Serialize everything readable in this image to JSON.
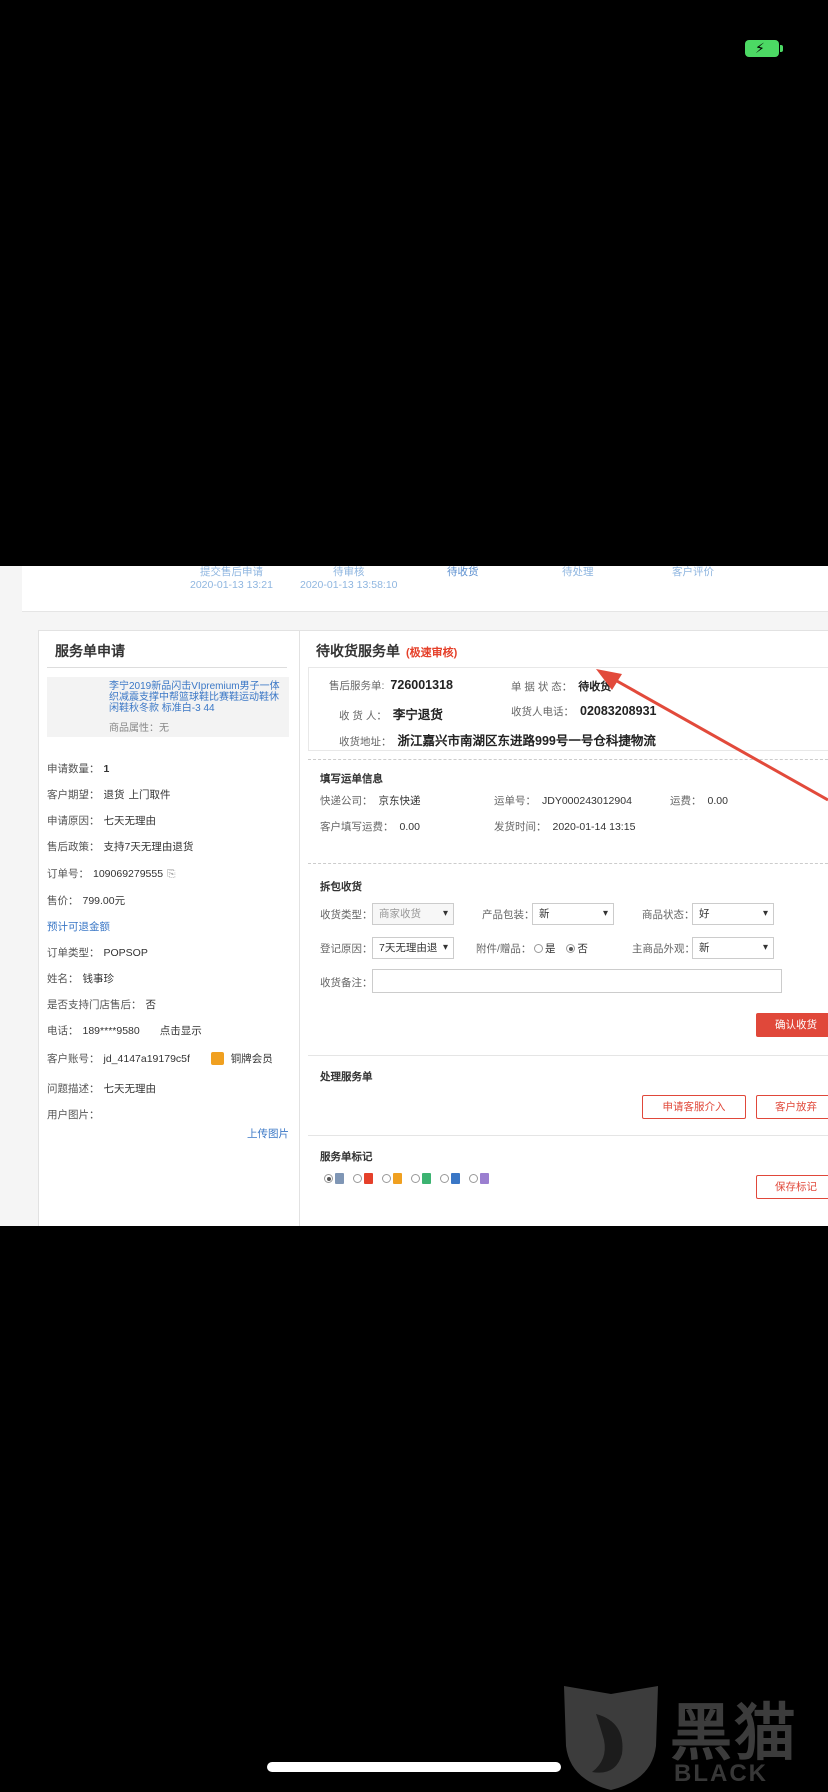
{
  "steps": [
    {
      "label": "提交售后申请",
      "time": "2020-01-13 13:21"
    },
    {
      "label": "待审核",
      "time": "2020-01-13 13:58:10"
    },
    {
      "label": "待收货",
      "time": ""
    },
    {
      "label": "待处理",
      "time": ""
    },
    {
      "label": "客户评价",
      "time": ""
    }
  ],
  "left": {
    "title": "服务单申请",
    "product_name": "李宁2019新品闪击VIpremium男子一体织减震支撑中帮篮球鞋比赛鞋运动鞋休闲鞋秋冬款 标准白-3 44",
    "product_attr_label": "商品属性：",
    "product_attr_value": "无",
    "qty_label": "申请数量：",
    "qty_value": "1",
    "expect_label": "客户期望：",
    "expect_value": "退货",
    "expect_extra": "上门取件",
    "reason_label": "申请原因：",
    "reason_value": "七天无理由",
    "policy_label": "售后政策：",
    "policy_value": "支持7天无理由退货",
    "order_label": "订单号：",
    "order_value": "109069279555",
    "price_label": "售价：",
    "price_value": "799.00元",
    "refund_link": "预计可退金额",
    "order_type_label": "订单类型：",
    "order_type_value": "POPSOP",
    "name_label": "姓名：",
    "name_value": "钱事珍",
    "store_label": "是否支持门店售后：",
    "store_value": "否",
    "phone_label": "电话：",
    "phone_value": "189****9580",
    "phone_link": "点击显示",
    "account_label": "客户账号：",
    "account_value": "jd_4147a19179c5f",
    "member_value": "铜牌会员",
    "issue_label": "问题描述：",
    "issue_value": "七天无理由",
    "images_label": "用户图片：",
    "upload_link": "上传图片"
  },
  "right": {
    "title": "待收货服务单",
    "badge": "(极速审核)",
    "service_no_label": "售后服务单:",
    "service_no_value": "726001318",
    "status_label": "单 据 状 态：",
    "status_value": "待收货",
    "receiver_label": "收 货 人：",
    "receiver_value": "李宁退货",
    "receiver_phone_label": "收货人电话：",
    "receiver_phone_value": "02083208931",
    "address_label": "收货地址：",
    "address_value": "浙江嘉兴市南湖区东进路999号一号仓科捷物流",
    "ship_section": "填写运单信息",
    "courier_label": "快递公司：",
    "courier_value": "京东快递",
    "waybill_label": "运单号：",
    "waybill_value": "JDY000243012904",
    "fee_label": "运费：",
    "fee_value": "0.00",
    "cust_fee_label": "客户填写运费：",
    "cust_fee_value": "0.00",
    "ship_time_label": "发货时间：",
    "ship_time_value": "2020-01-14 13:15",
    "unpack_section": "拆包收货",
    "recv_type_label": "收货类型：",
    "recv_type_value": "商家收货",
    "packaging_label": "产品包装：",
    "packaging_value": "新",
    "goods_state_label": "商品状态：",
    "goods_state_value": "好",
    "reg_reason_label": "登记原因：",
    "reg_reason_value": "7天无理由退",
    "accessory_label": "附件/赠品：",
    "accessory_yes": "是",
    "accessory_no": "否",
    "appearance_label": "主商品外观：",
    "appearance_value": "新",
    "remark_label": "收货备注：",
    "confirm_button": "确认收货",
    "process_section": "处理服务单",
    "intervene_button": "申请客服介入",
    "giveup_button": "客户放弃",
    "mark_section": "服务单标记",
    "save_mark_button": "保存标记",
    "flag_colors": [
      "#7f96b5",
      "#e5402a",
      "#f0a020",
      "#3cb371",
      "#3a77c6",
      "#9b7fd0"
    ]
  },
  "watermark": {
    "text": "黑猫",
    "sub": "BLACK CAT"
  }
}
